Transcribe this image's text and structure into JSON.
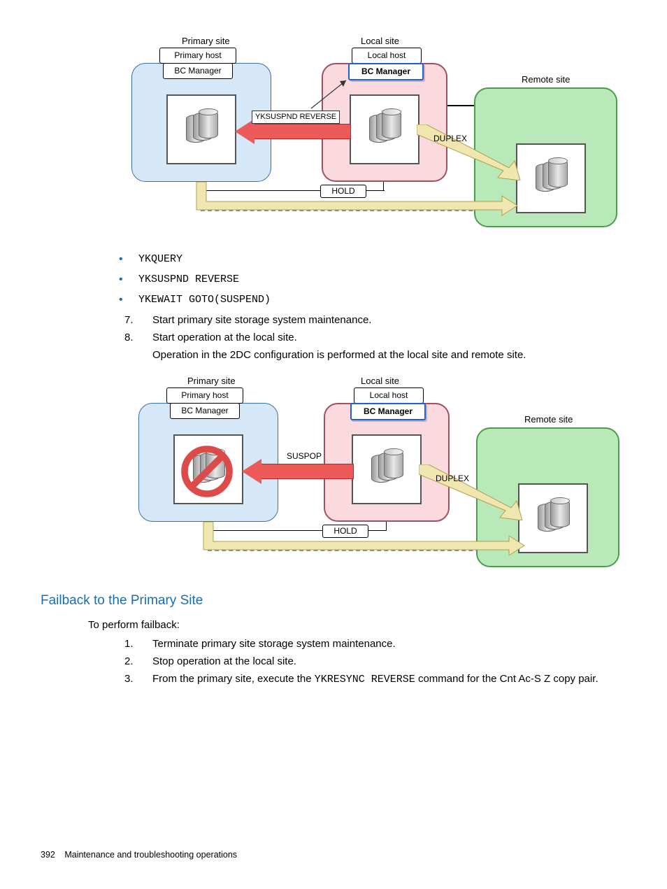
{
  "diagram1": {
    "primary_site": "Primary site",
    "primary_host": "Primary host",
    "primary_bc": "BC Manager",
    "local_site": "Local site",
    "local_host": "Local host",
    "local_bc": "BC Manager",
    "remote_site": "Remote site",
    "cmd_label": "YKSUSPND REVERSE",
    "state_duplex": "DUPLEX",
    "state_hold": "HOLD"
  },
  "bullets": {
    "b1": "YKQUERY",
    "b2": "YKSUSPND REVERSE",
    "b3": "YKEWAIT GOTO(SUSPEND)"
  },
  "steps_a": {
    "n7": "7.",
    "t7": "Start primary site storage system maintenance.",
    "n8": "8.",
    "t8": "Start operation at the local site.",
    "t8b": "Operation in the 2DC configuration is performed at the local site and remote site."
  },
  "diagram2": {
    "primary_site": "Primary site",
    "primary_host": "Primary host",
    "primary_bc": "BC Manager",
    "local_site": "Local site",
    "local_host": "Local host",
    "local_bc": "BC Manager",
    "remote_site": "Remote site",
    "cmd_label": "SUSPOP",
    "state_duplex": "DUPLEX",
    "state_hold": "HOLD"
  },
  "section_heading": "Failback to the Primary Site",
  "failback_intro": "To perform failback:",
  "steps_b": {
    "n1": "1.",
    "t1": "Terminate primary site storage system maintenance.",
    "n2": "2.",
    "t2": "Stop operation at the local site.",
    "n3": "3.",
    "t3a": "From the primary site, execute the ",
    "t3code": "YKRESYNC REVERSE",
    "t3b": " command for the Cnt Ac-S Z copy pair."
  },
  "footer": {
    "page": "392",
    "title": "Maintenance and troubleshooting operations"
  }
}
